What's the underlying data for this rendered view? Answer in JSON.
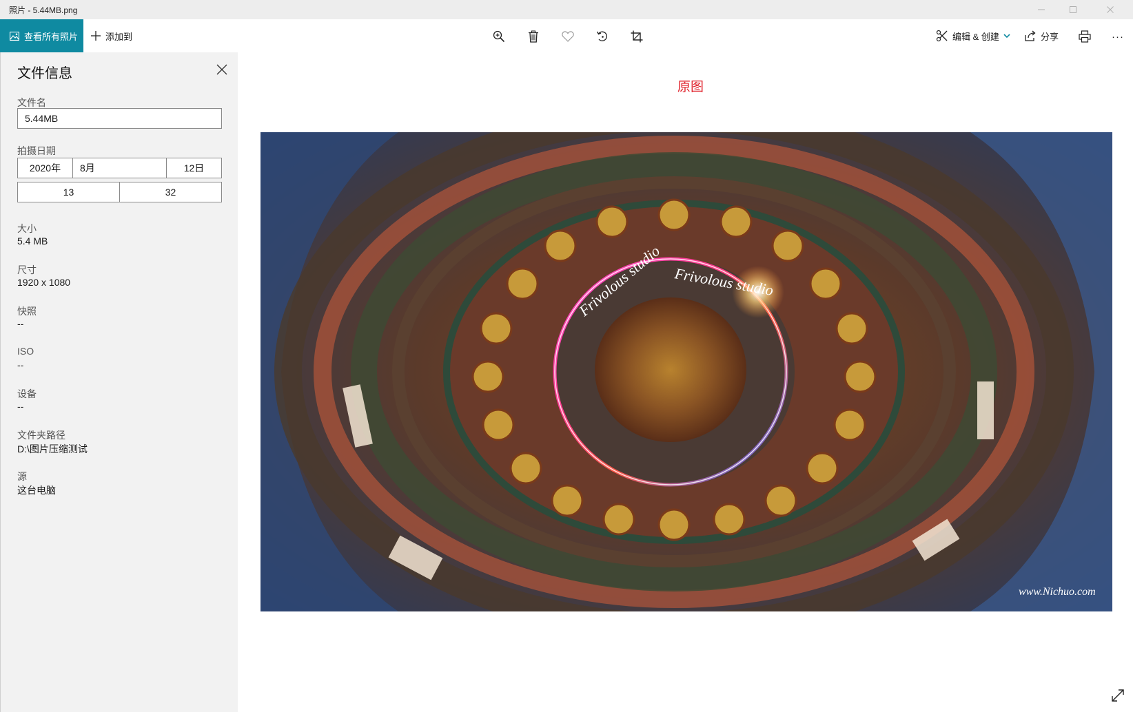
{
  "window": {
    "title": "照片 - 5.44MB.png"
  },
  "toolbar": {
    "view_all_label": "查看所有照片",
    "add_to_label": "添加到",
    "edit_create_label": "编辑 & 创建",
    "share_label": "分享",
    "more_label": "···"
  },
  "panel": {
    "title": "文件信息",
    "filename_label": "文件名",
    "filename_value": "5.44MB",
    "date_label": "拍摄日期",
    "date_year": "2020年",
    "date_month": "8月",
    "date_day": "12日",
    "time_hour": "13",
    "time_minute": "32",
    "size_label": "大小",
    "size_value": "5.4 MB",
    "dimensions_label": "尺寸",
    "dimensions_value": "1920 x 1080",
    "snapshot_label": "快照",
    "snapshot_value": "--",
    "iso_label": "ISO",
    "iso_value": "--",
    "device_label": "设备",
    "device_value": "--",
    "folder_label": "文件夹路径",
    "folder_value": "D:\\图片压缩测试",
    "source_label": "源",
    "source_value": "这台电脑"
  },
  "content": {
    "caption": "原图",
    "watermark_ring_text": "Frivolous studio",
    "watermark_corner": "www.Nichuo.com"
  },
  "colors": {
    "accent": "#0f8aa1",
    "caption": "#e0212a",
    "panel_bg": "#f2f2f2"
  },
  "icons": [
    "photos-icon",
    "plus-icon",
    "zoom-in-icon",
    "delete-icon",
    "heart-icon",
    "rotate-icon",
    "crop-icon",
    "edit-create-icon",
    "chevron-down-icon",
    "share-icon",
    "print-icon",
    "more-icon",
    "close-icon",
    "expand-icon",
    "minimize-icon",
    "maximize-icon"
  ]
}
